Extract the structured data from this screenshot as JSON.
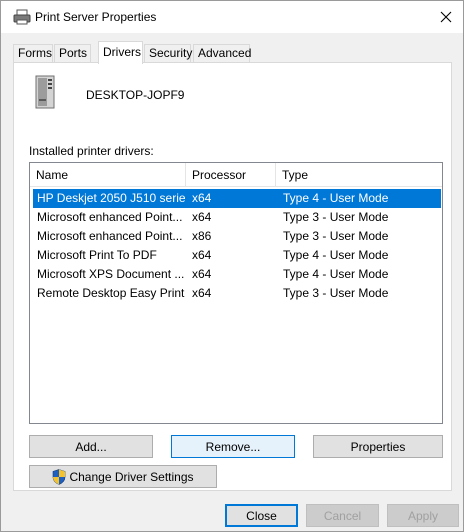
{
  "window": {
    "title": "Print Server Properties"
  },
  "tabs": [
    {
      "label": "Forms",
      "active": false
    },
    {
      "label": "Ports",
      "active": false
    },
    {
      "label": "Drivers",
      "active": true
    },
    {
      "label": "Security",
      "active": false
    },
    {
      "label": "Advanced",
      "active": false
    }
  ],
  "server": {
    "name": "DESKTOP-JOPF9",
    "icon": "server-tower-icon"
  },
  "drivers": {
    "label": "Installed printer drivers:",
    "columns": [
      "Name",
      "Processor",
      "Type"
    ],
    "rows": [
      {
        "name": "HP Deskjet 2050 J510 serie...",
        "processor": "x64",
        "type": "Type 4 - User Mode",
        "selected": true
      },
      {
        "name": "Microsoft enhanced Point...",
        "processor": "x64",
        "type": "Type 3 - User Mode",
        "selected": false
      },
      {
        "name": "Microsoft enhanced Point...",
        "processor": "x86",
        "type": "Type 3 - User Mode",
        "selected": false
      },
      {
        "name": "Microsoft Print To PDF",
        "processor": "x64",
        "type": "Type 4 - User Mode",
        "selected": false
      },
      {
        "name": "Microsoft XPS Document ...",
        "processor": "x64",
        "type": "Type 4 - User Mode",
        "selected": false
      },
      {
        "name": "Remote Desktop Easy Print",
        "processor": "x64",
        "type": "Type 3 - User Mode",
        "selected": false
      }
    ]
  },
  "buttons": {
    "add": "Add...",
    "remove": "Remove...",
    "properties": "Properties",
    "change_driver_settings": "Change Driver Settings"
  },
  "footer": {
    "close": "Close",
    "cancel": "Cancel",
    "apply": "Apply"
  },
  "colors": {
    "selection": "#0078d7",
    "accent": "#0078d7",
    "disabled_text": "#a0a0a0"
  }
}
